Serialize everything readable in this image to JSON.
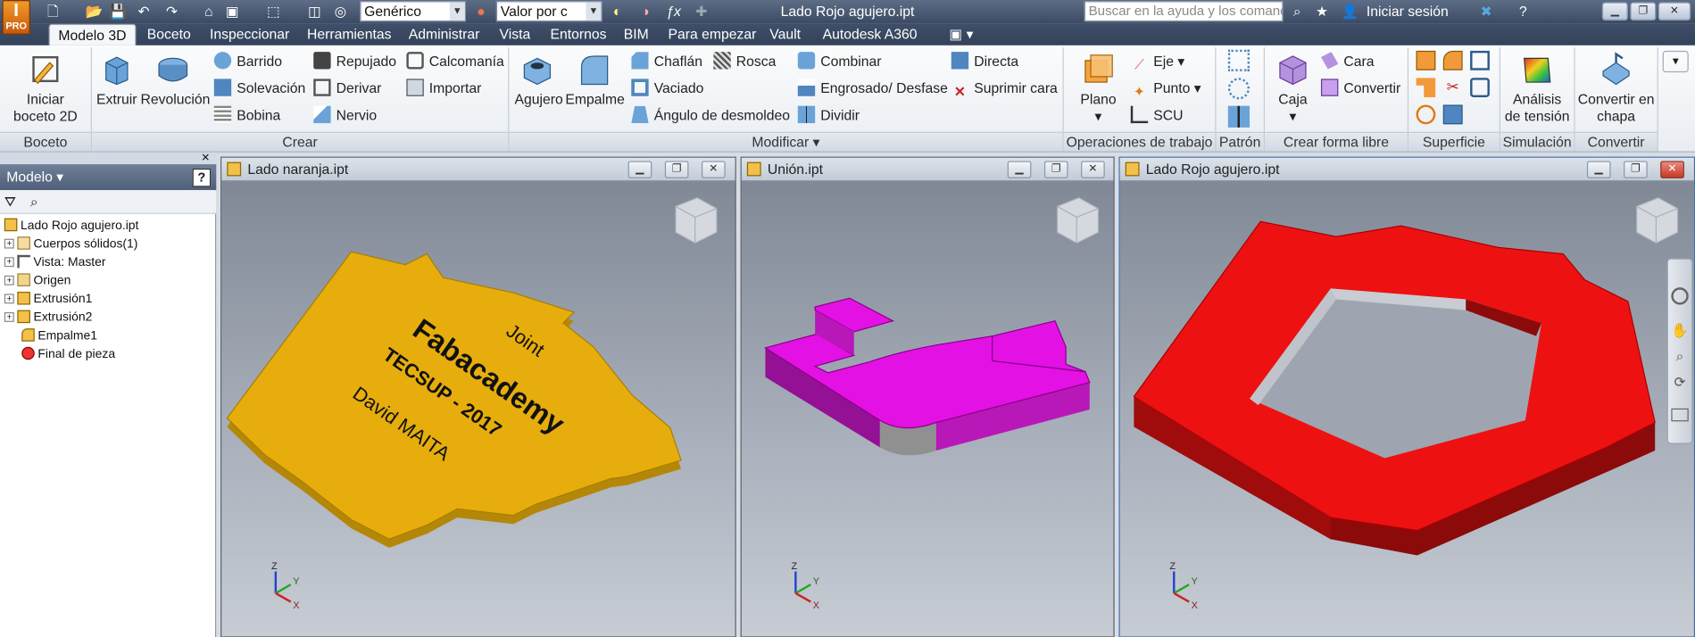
{
  "titlebar": {
    "document_title": "Lado Rojo agujero.ipt",
    "material_combo": "Genérico",
    "appearance_combo": "Valor por c",
    "help_search_placeholder": "Buscar en la ayuda y los comand",
    "signin_label": "Iniciar sesión",
    "logo_text": "I",
    "logo_sub": "PRO"
  },
  "tabs": [
    "Modelo 3D",
    "Boceto",
    "Inspeccionar",
    "Herramientas",
    "Administrar",
    "Vista",
    "Entornos",
    "BIM",
    "Para empezar",
    "Vault",
    "Autodesk A360"
  ],
  "ribbon": {
    "panels": [
      "Boceto",
      "Crear",
      "Modificar ▾",
      "Operaciones de trabajo",
      "Patrón",
      "Crear forma libre",
      "Superficie",
      "Simulación",
      "Convertir"
    ],
    "boceto": {
      "iniciar": "Iniciar",
      "iniciar2": "boceto 2D"
    },
    "crear": {
      "extruir": "Extruir",
      "revolucion": "Revolución",
      "barrido": "Barrido",
      "solevacion": "Solevación",
      "bobina": "Bobina",
      "repujado": "Repujado",
      "derivar": "Derivar",
      "nervio": "Nervio",
      "calcomania": "Calcomanía",
      "importar": "Importar"
    },
    "modificar": {
      "agujero": "Agujero",
      "empalme": "Empalme",
      "chaflan": "Chaflán",
      "rosca": "Rosca",
      "vaciado": "Vaciado",
      "angulo": "Ángulo de desmoldeo",
      "combinar": "Combinar",
      "engrosado": "Engrosado/ Desfase",
      "dividir": "Dividir",
      "directa": "Directa",
      "suprimir": "Suprimir cara"
    },
    "trabajo": {
      "plano": "Plano",
      "eje": "Eje",
      "punto": "Punto",
      "scu": "SCU"
    },
    "forma_libre": {
      "caja": "Caja",
      "cara": "Cara",
      "convertir": "Convertir"
    },
    "simulacion": {
      "l1": "Análisis",
      "l2": "de tensión"
    },
    "convertir": {
      "l1": "Convertir en",
      "l2": "chapa"
    }
  },
  "browser": {
    "header": "Modelo ▾",
    "items": [
      {
        "label": "Lado Rojo agujero.ipt"
      },
      {
        "label": "Cuerpos sólidos(1)"
      },
      {
        "label": "Vista: Master"
      },
      {
        "label": "Origen"
      },
      {
        "label": "Extrusión1"
      },
      {
        "label": "Extrusión2"
      },
      {
        "label": "Empalme1"
      },
      {
        "label": "Final de pieza"
      }
    ]
  },
  "viewports": {
    "v1": {
      "title": "Lado naranja.ipt",
      "text1": "Joint",
      "text2": "Fabacademy",
      "text3": "TECSUP - 2017",
      "text4": "David MAITA"
    },
    "v2": {
      "title": "Unión.ipt"
    },
    "v3": {
      "title": "Lado Rojo agujero.ipt"
    }
  },
  "colors": {
    "orange_part": "#e6ad0c",
    "magenta_part": "#e411e4",
    "red_part": "#ee1111"
  }
}
